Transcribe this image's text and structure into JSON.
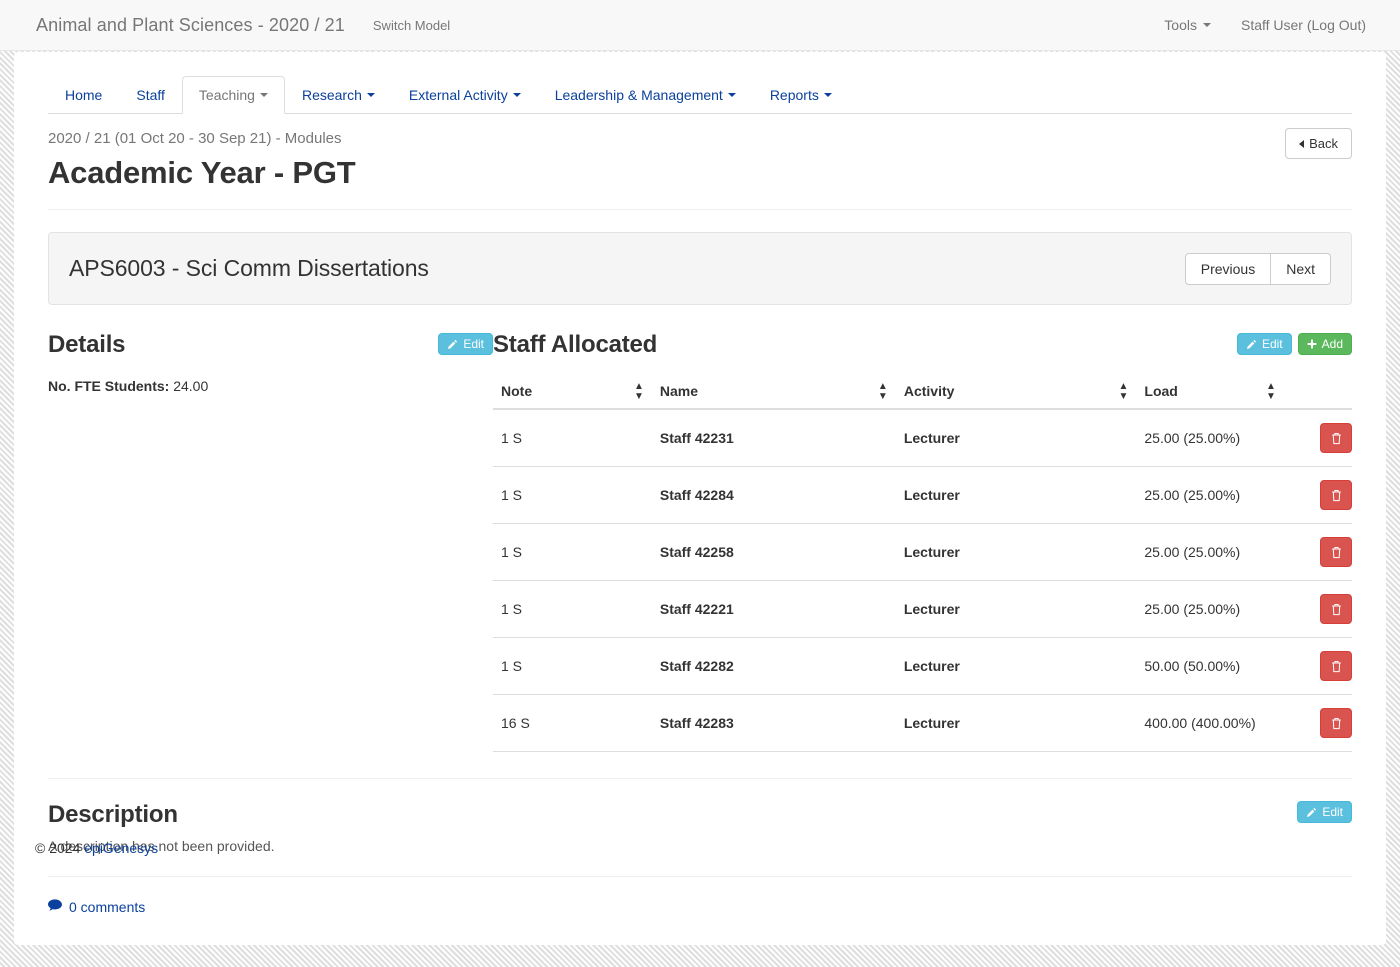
{
  "topbar": {
    "brand": "Animal and Plant Sciences - 2020 / 21",
    "switch_model": "Switch Model",
    "tools": "Tools",
    "user": "Staff User (Log Out)"
  },
  "nav_tabs": [
    {
      "label": "Home",
      "active": false,
      "caret": false
    },
    {
      "label": "Staff",
      "active": false,
      "caret": false
    },
    {
      "label": "Teaching",
      "active": true,
      "caret": true
    },
    {
      "label": "Research",
      "active": false,
      "caret": true
    },
    {
      "label": "External Activity",
      "active": false,
      "caret": true
    },
    {
      "label": "Leadership & Management",
      "active": false,
      "caret": true
    },
    {
      "label": "Reports",
      "active": false,
      "caret": true
    }
  ],
  "page": {
    "breadcrumb": "2020 / 21 (01 Oct 20 - 30 Sep 21) - Modules",
    "title": "Academic Year - PGT",
    "back_label": "Back"
  },
  "module": {
    "title": "APS6003 - Sci Comm Dissertations",
    "previous_label": "Previous",
    "next_label": "Next"
  },
  "details": {
    "title": "Details",
    "edit_label": "Edit",
    "fte_label": "No. FTE Students:",
    "fte_value": "24.00"
  },
  "staff_allocated": {
    "title": "Staff Allocated",
    "edit_label": "Edit",
    "add_label": "Add",
    "columns": [
      "Note",
      "Name",
      "Activity",
      "Load",
      ""
    ],
    "rows": [
      {
        "note": "1 S",
        "name": "Staff 42231",
        "activity": "Lecturer",
        "load": "25.00 (25.00%)"
      },
      {
        "note": "1 S",
        "name": "Staff 42284",
        "activity": "Lecturer",
        "load": "25.00 (25.00%)"
      },
      {
        "note": "1 S",
        "name": "Staff 42258",
        "activity": "Lecturer",
        "load": "25.00 (25.00%)"
      },
      {
        "note": "1 S",
        "name": "Staff 42221",
        "activity": "Lecturer",
        "load": "25.00 (25.00%)"
      },
      {
        "note": "1 S",
        "name": "Staff 42282",
        "activity": "Lecturer",
        "load": "50.00 (50.00%)"
      },
      {
        "note": "16 S",
        "name": "Staff 42283",
        "activity": "Lecturer",
        "load": "400.00 (400.00%)"
      }
    ]
  },
  "description": {
    "title": "Description",
    "text": "A description has not been provided.",
    "edit_label": "Edit"
  },
  "comments": {
    "label": "0 comments"
  },
  "footer": {
    "copyright": "© 2024",
    "link": "epiGenesys"
  },
  "colors": {
    "link": "#0b409c",
    "info": "#5bc0de",
    "success": "#5cb85c",
    "danger": "#d9534f",
    "muted": "#777777",
    "panel_bg": "#f5f5f5",
    "page_bg": "#e9e9e9"
  }
}
